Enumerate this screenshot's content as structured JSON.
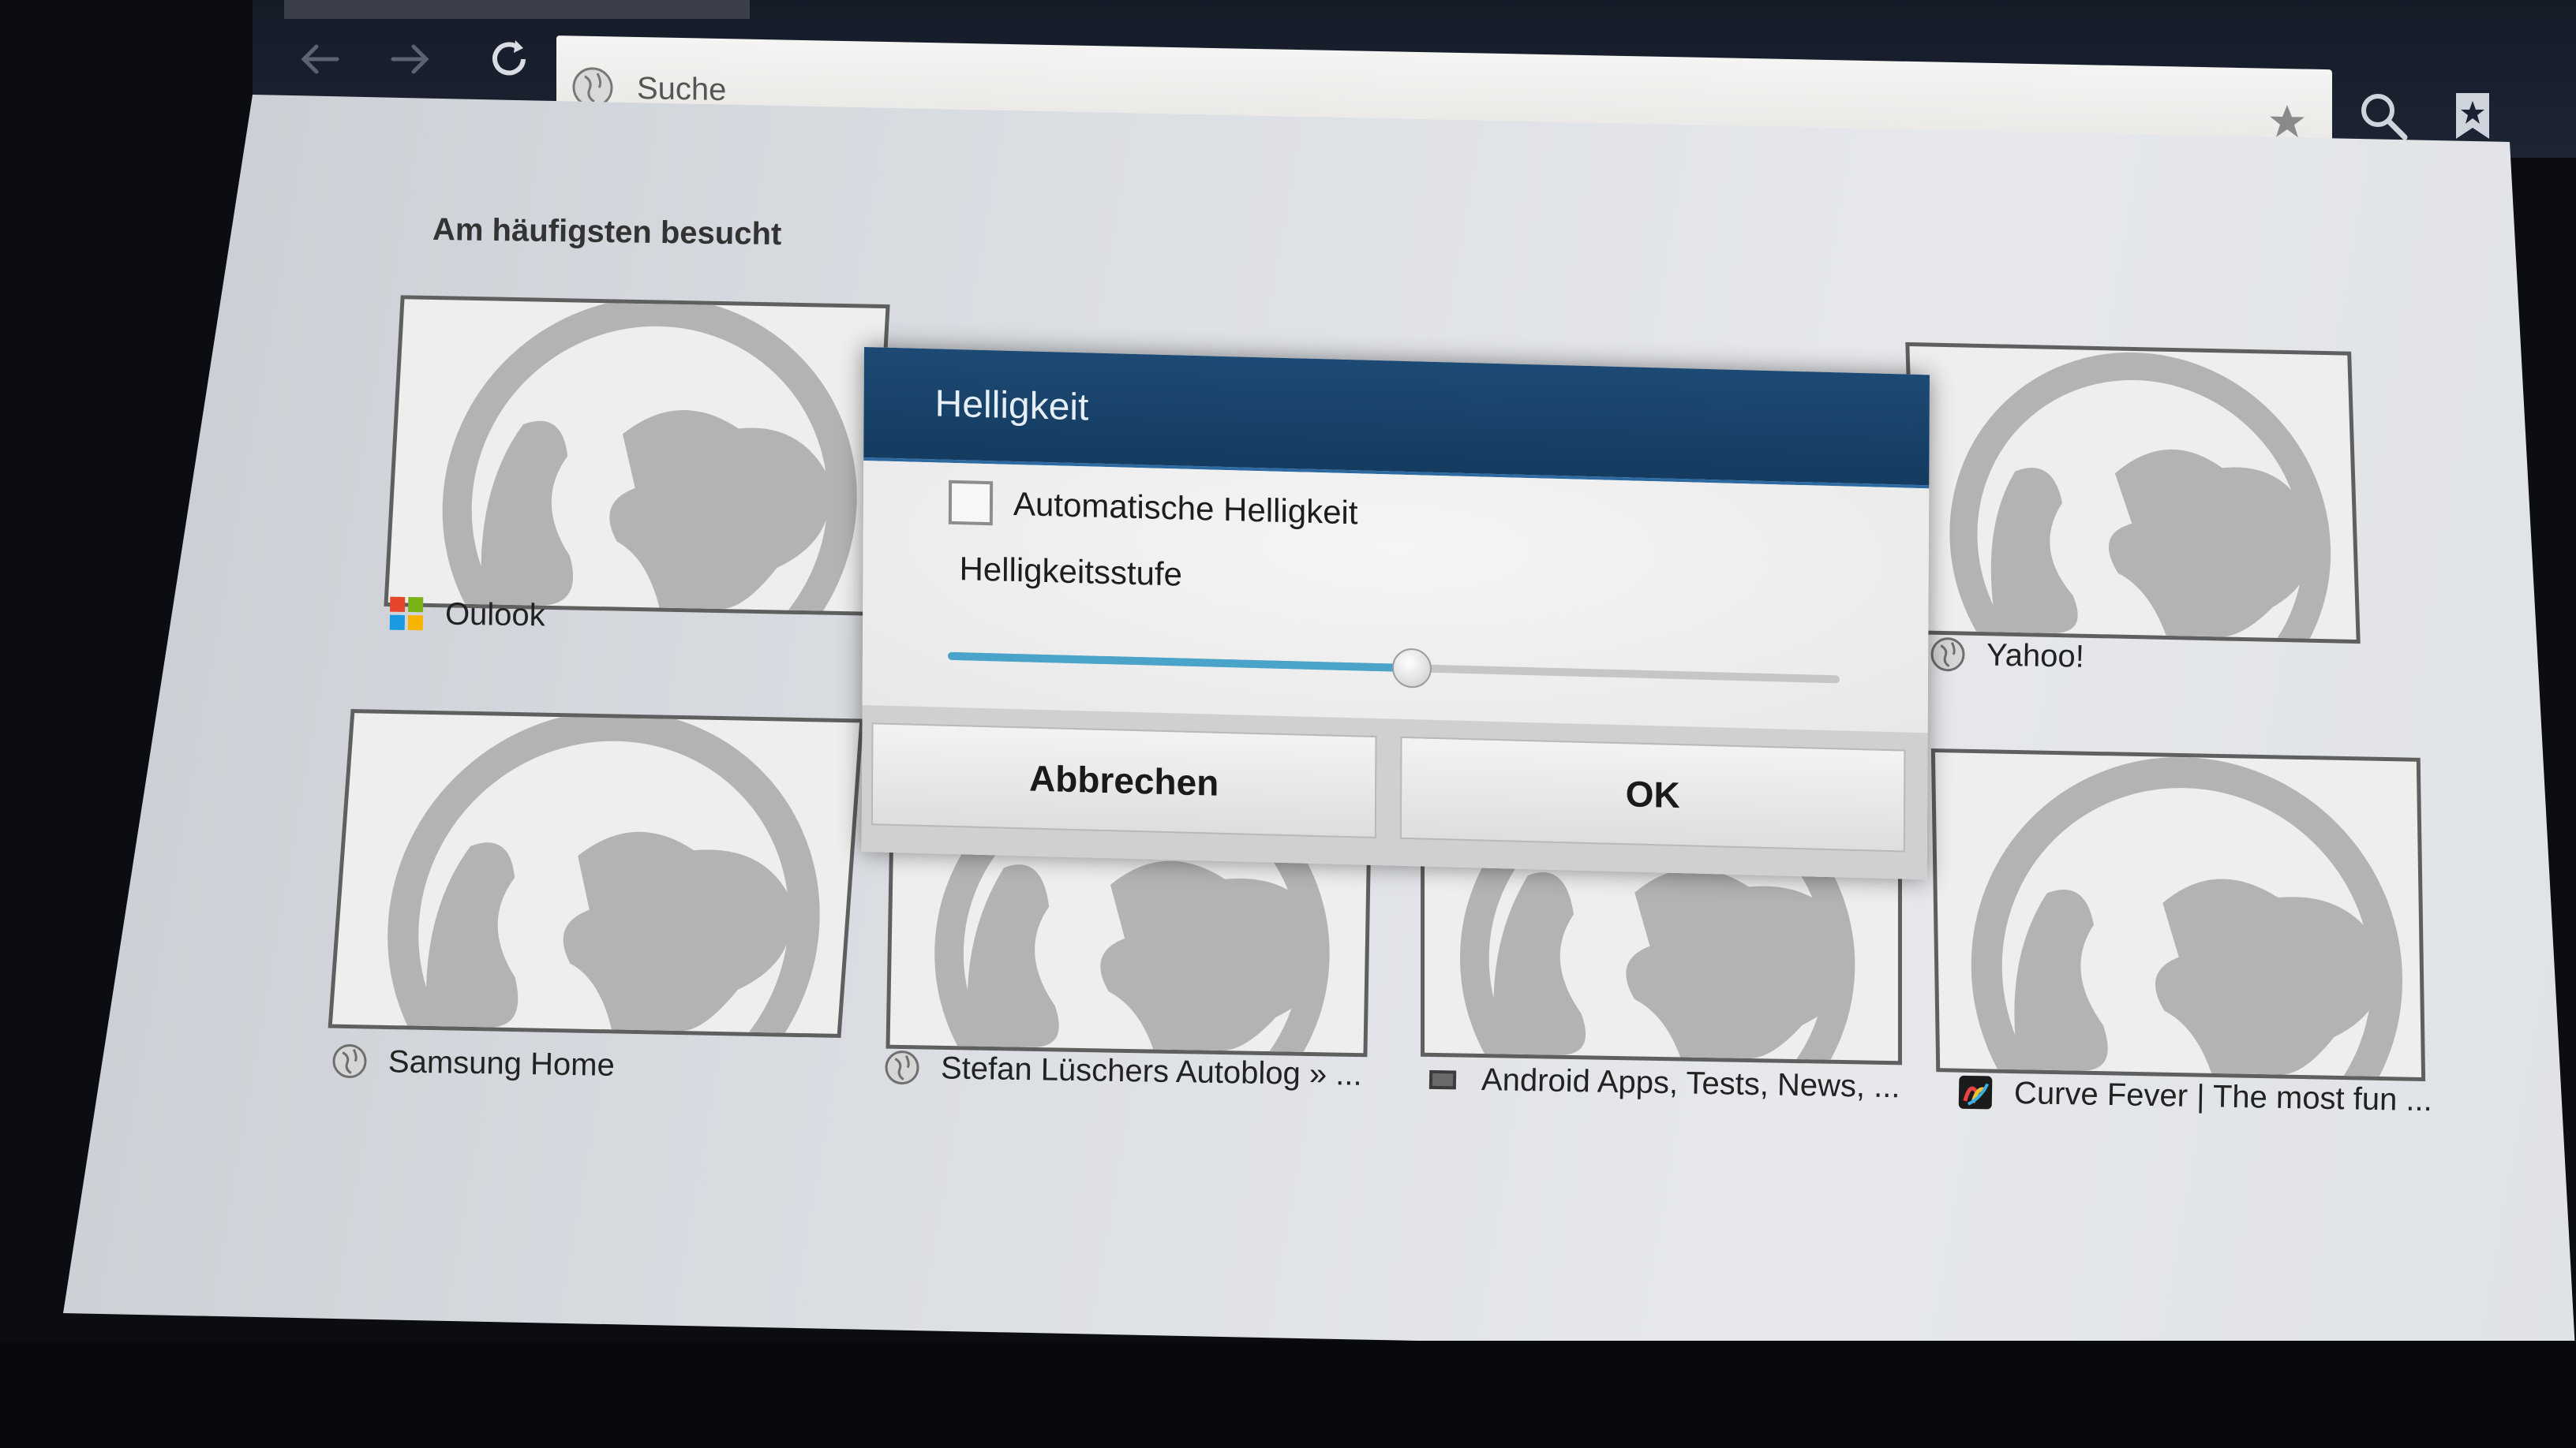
{
  "browser": {
    "address_bar": {
      "text": "Suche"
    },
    "icons": [
      "back-arrow-icon",
      "forward-arrow-icon",
      "reload-icon",
      "globe-icon",
      "star-icon",
      "search-icon",
      "bookmarks-icon"
    ]
  },
  "page": {
    "section_title": "Am häufigsten besucht",
    "tiles": [
      {
        "label": "Oulook",
        "favicon": "microsoft-logo-icon"
      },
      {
        "label": "Yahoo!",
        "favicon": "globe-icon"
      },
      {
        "label": "Samsung Home",
        "favicon": "globe-icon"
      },
      {
        "label": "Stefan Lüschers Autoblog » ...",
        "favicon": "globe-icon"
      },
      {
        "label": "Android Apps, Tests, News, ...",
        "favicon": "site-icon"
      },
      {
        "label": "Curve Fever | The most fun ...",
        "favicon": "curve-fever-icon"
      }
    ]
  },
  "dialog": {
    "title": "Helligkeit",
    "auto_checkbox": {
      "label": "Automatische Helligkeit",
      "checked": false
    },
    "level_label": "Helligkeitsstufe",
    "brightness_level": 0.52,
    "buttons": {
      "cancel": "Abbrechen",
      "ok": "OK"
    },
    "colors": {
      "header": "#1d4a74",
      "slider_fill": "#4aa3c8"
    }
  }
}
